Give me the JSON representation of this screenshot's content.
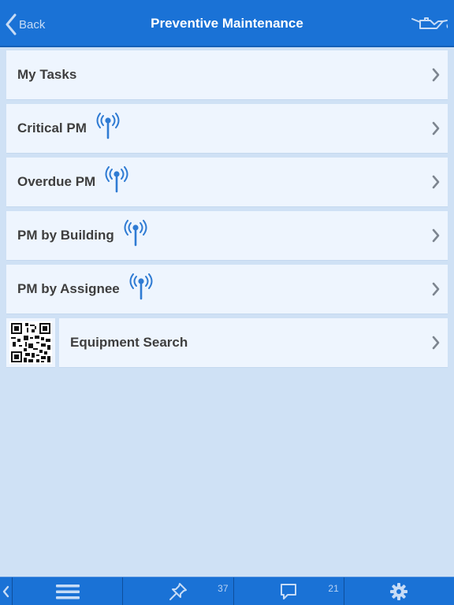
{
  "navbar": {
    "back_label": "Back",
    "title": "Preventive Maintenance",
    "right_icon": "oil-can-icon"
  },
  "list": {
    "items": [
      {
        "label": "My Tasks",
        "icon": null
      },
      {
        "label": "Critical PM",
        "icon": "signal-antenna-icon"
      },
      {
        "label": "Overdue PM",
        "icon": "signal-antenna-icon"
      },
      {
        "label": "PM by Building",
        "icon": "signal-antenna-icon"
      },
      {
        "label": "PM by Assignee",
        "icon": "signal-antenna-icon"
      }
    ],
    "equipment_search": {
      "label": "Equipment Search",
      "icon": "qr-code-icon"
    }
  },
  "tabbar": {
    "tabs": [
      {
        "icon": "menu-icon",
        "badge": ""
      },
      {
        "icon": "pin-icon",
        "badge": "37"
      },
      {
        "icon": "chat-bubble-icon",
        "badge": "21"
      },
      {
        "icon": "gear-icon",
        "badge": ""
      }
    ]
  },
  "colors": {
    "accent": "#1a72d6",
    "background": "#cfe1f5",
    "row": "#eef5fe",
    "label": "#3e3e3e",
    "icon_blue": "#2f7bd3",
    "chevron": "#7d8590"
  }
}
